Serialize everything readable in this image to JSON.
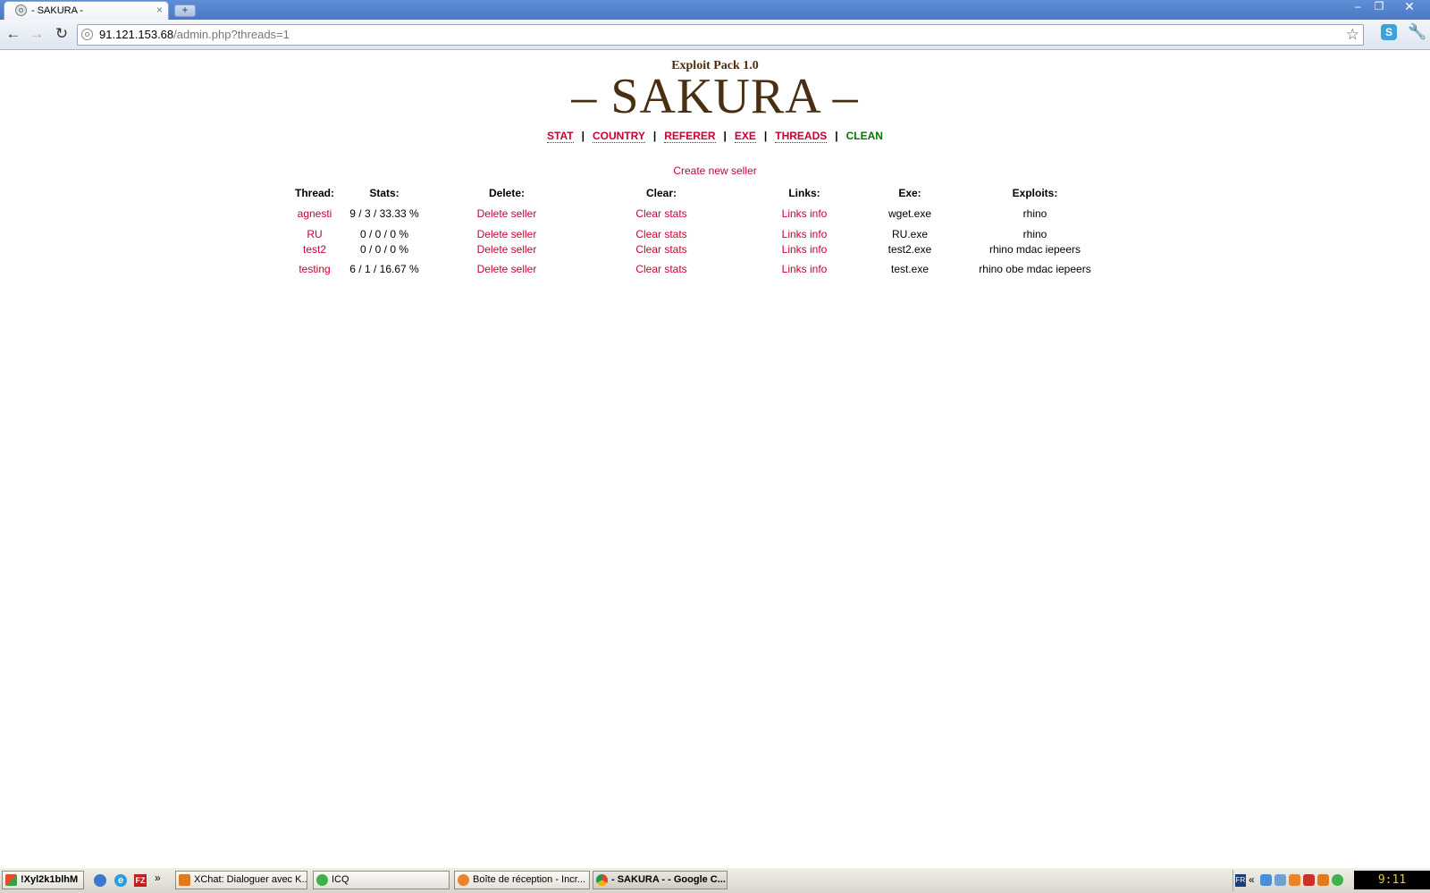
{
  "browser": {
    "tab_title": "- SAKURA -",
    "tab_close": "×",
    "new_tab": "+",
    "window_controls": {
      "minimize": "–",
      "restore": "❐",
      "close": "✕"
    },
    "nav": {
      "back": "←",
      "forward": "→",
      "reload": "↻"
    },
    "url_host": "91.121.153.68",
    "url_path": "/admin.php?threads=1",
    "bookmark_star": "☆",
    "extension_label": "S",
    "wrench": "🔧"
  },
  "header": {
    "subtitle": "Exploit Pack 1.0",
    "logo": "– SAKURA –"
  },
  "menu": {
    "items": [
      "STAT",
      "COUNTRY",
      "REFERER",
      "EXE",
      "THREADS",
      "CLEAN"
    ],
    "separator": "|"
  },
  "create_link": "Create new seller",
  "table": {
    "columns": [
      "Thread:",
      "Stats:",
      "Delete:",
      "Clear:",
      "Links:",
      "Exe:",
      "Exploits:"
    ],
    "rows": [
      {
        "thread": "agnesti",
        "stats": "9 / 3 / 33.33 %",
        "delete": "Delete seller",
        "clear": "Clear stats",
        "links": "Links info",
        "exe": "wget.exe",
        "exploits": "rhino"
      },
      {
        "thread": "RU",
        "stats": "0 / 0 / 0 %",
        "delete": "Delete seller",
        "clear": "Clear stats",
        "links": "Links info",
        "exe": "RU.exe",
        "exploits": "rhino"
      },
      {
        "thread": "test2",
        "stats": "0 / 0 / 0 %",
        "delete": "Delete seller",
        "clear": "Clear stats",
        "links": "Links info",
        "exe": "test2.exe",
        "exploits": "rhino mdac iepeers"
      },
      {
        "thread": "testing",
        "stats": "6 / 1 / 16.67 %",
        "delete": "Delete seller",
        "clear": "Clear stats",
        "links": "Links info",
        "exe": "test.exe",
        "exploits": "rhino obe mdac iepeers"
      }
    ]
  },
  "taskbar": {
    "start": "!Xyl2k1blhM",
    "quick_launch_more": "»",
    "ie_label": "e",
    "filezilla_label": "FZ",
    "items": [
      "XChat: Dialoguer avec K...",
      "ICQ",
      "Boîte de réception - Incr...",
      "- SAKURA - - Google C..."
    ],
    "tray_lang": "FR",
    "tray_more": "«",
    "clock": "9:11"
  },
  "colors": {
    "link": "#cc0033",
    "clean_link": "#007700",
    "logo": "#4a2e12"
  }
}
